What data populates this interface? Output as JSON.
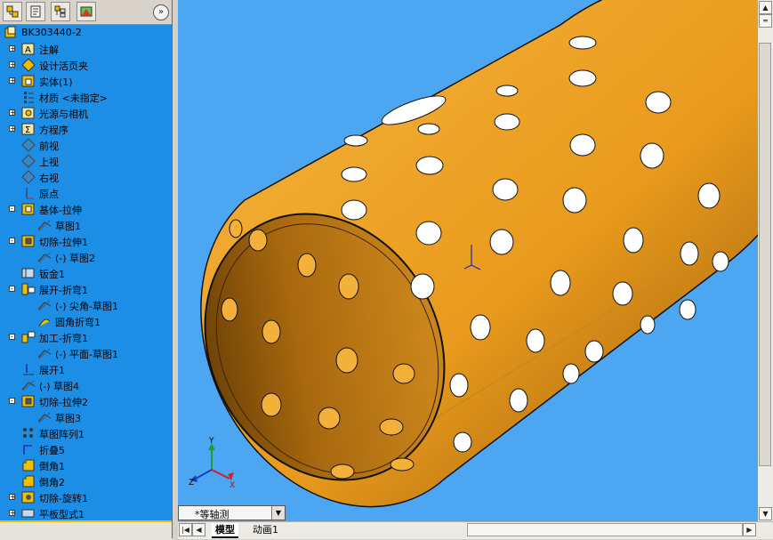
{
  "toolbar": {
    "tabs": [
      {
        "icon": "feature-manager-icon"
      },
      {
        "icon": "property-manager-icon"
      },
      {
        "icon": "configuration-manager-icon"
      },
      {
        "icon": "display-manager-icon"
      }
    ],
    "collapse_glyph": "»"
  },
  "tree": {
    "items": [
      {
        "label": "BK303440-2",
        "expander": "",
        "icon": "part-icon",
        "indent": 0
      },
      {
        "label": "注解",
        "expander": "+",
        "icon": "annotations-icon",
        "indent": 1
      },
      {
        "label": "设计活页夹",
        "expander": "+",
        "icon": "design-binder-icon",
        "indent": 1
      },
      {
        "label": "实体(1)",
        "expander": "+",
        "icon": "solid-bodies-icon",
        "indent": 1
      },
      {
        "label": "材质 <未指定>",
        "expander": "",
        "icon": "material-icon",
        "indent": 1
      },
      {
        "label": "光源与相机",
        "expander": "+",
        "icon": "lights-cameras-icon",
        "indent": 1
      },
      {
        "label": "方程序",
        "expander": "+",
        "icon": "equations-icon",
        "indent": 1
      },
      {
        "label": "前视",
        "expander": "",
        "icon": "plane-icon",
        "indent": 1
      },
      {
        "label": "上视",
        "expander": "",
        "icon": "plane-icon",
        "indent": 1
      },
      {
        "label": "右视",
        "expander": "",
        "icon": "plane-icon",
        "indent": 1
      },
      {
        "label": "原点",
        "expander": "",
        "icon": "origin-icon",
        "indent": 1
      },
      {
        "label": "基体-拉伸",
        "expander": "−",
        "icon": "extrude-icon",
        "indent": 1
      },
      {
        "label": "草图1",
        "expander": "",
        "icon": "sketch-icon",
        "indent": 2
      },
      {
        "label": "切除-拉伸1",
        "expander": "−",
        "icon": "cut-extrude-icon",
        "indent": 1
      },
      {
        "label": "(-) 草图2",
        "expander": "",
        "icon": "sketch-icon",
        "indent": 2
      },
      {
        "label": "钣金1",
        "expander": "",
        "icon": "sheet-metal-icon",
        "indent": 1
      },
      {
        "label": "展开-折弯1",
        "expander": "−",
        "icon": "flatten-bends-icon",
        "indent": 1
      },
      {
        "label": "(-) 尖角-草图1",
        "expander": "",
        "icon": "sketch-icon",
        "indent": 2
      },
      {
        "label": "圆角折弯1",
        "expander": "",
        "icon": "round-bend-icon",
        "indent": 2
      },
      {
        "label": "加工-折弯1",
        "expander": "−",
        "icon": "process-bends-icon",
        "indent": 1
      },
      {
        "label": "(-) 平面-草图1",
        "expander": "",
        "icon": "sketch-icon",
        "indent": 2
      },
      {
        "label": "展开1",
        "expander": "",
        "icon": "unfold-icon",
        "indent": 1
      },
      {
        "label": "(-) 草图4",
        "expander": "",
        "icon": "sketch-icon",
        "indent": 1
      },
      {
        "label": "切除-拉伸2",
        "expander": "−",
        "icon": "cut-extrude-icon",
        "indent": 1
      },
      {
        "label": "草图3",
        "expander": "",
        "icon": "sketch-icon",
        "indent": 2
      },
      {
        "label": "草图阵列1",
        "expander": "",
        "icon": "sketch-pattern-icon",
        "indent": 1
      },
      {
        "label": "折叠5",
        "expander": "",
        "icon": "fold-icon",
        "indent": 1
      },
      {
        "label": "倒角1",
        "expander": "",
        "icon": "chamfer-icon",
        "indent": 1
      },
      {
        "label": "倒角2",
        "expander": "",
        "icon": "chamfer-icon",
        "indent": 1
      },
      {
        "label": "切除-旋转1",
        "expander": "+",
        "icon": "cut-revolve-icon",
        "indent": 1
      },
      {
        "label": "平板型式1",
        "expander": "+",
        "icon": "flat-pattern-icon",
        "indent": 1
      }
    ]
  },
  "viewport": {
    "triad": {
      "x": "X",
      "y": "Y",
      "z": "Z"
    },
    "view_selector": "*等轴测"
  },
  "bottom_tabs": [
    {
      "label": "模型",
      "active": true
    },
    {
      "label": "动画1",
      "active": false
    }
  ],
  "colors": {
    "tree_bg": "#1c8ee6",
    "viewport_bg": "#4da6f1",
    "part_color": "#f2a11f",
    "edge_color": "#111111"
  }
}
